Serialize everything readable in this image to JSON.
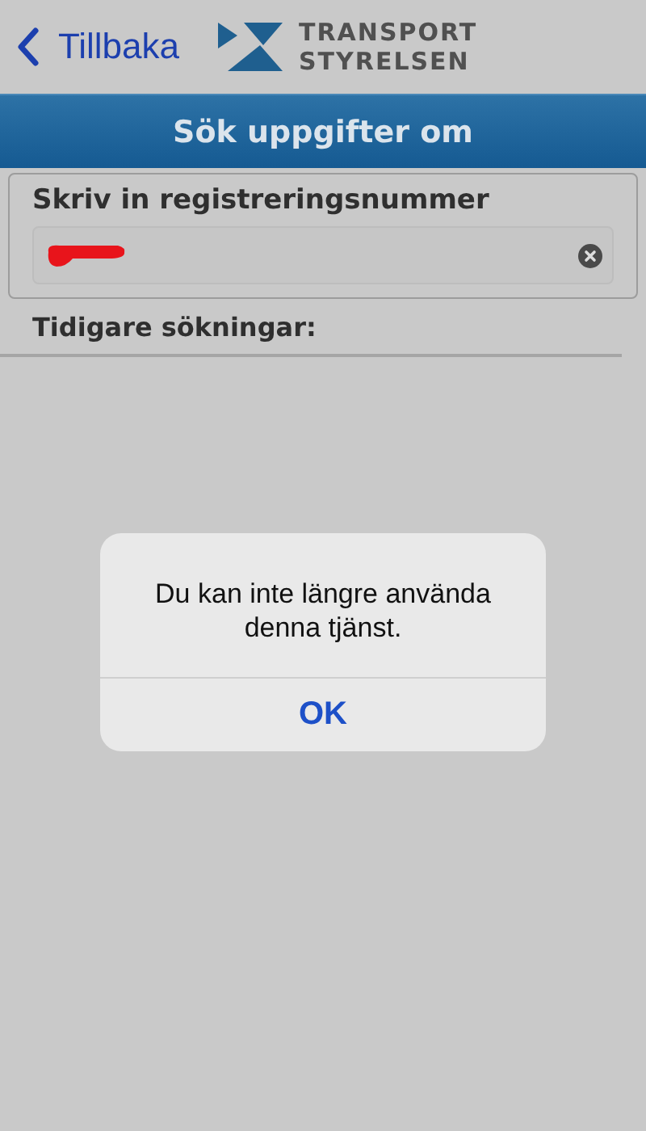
{
  "nav": {
    "back_label": "Tillbaka",
    "logo_lines": [
      "TRANSPORT",
      "STYRELSEN"
    ]
  },
  "header": {
    "title": "Sök uppgifter om"
  },
  "search": {
    "label": "Skriv in registreringsnummer",
    "value_redacted": true
  },
  "history": {
    "title": "Tidigare sökningar:"
  },
  "alert": {
    "message": "Du kan inte längre använda denna tjänst.",
    "buttons": [
      "OK"
    ]
  }
}
